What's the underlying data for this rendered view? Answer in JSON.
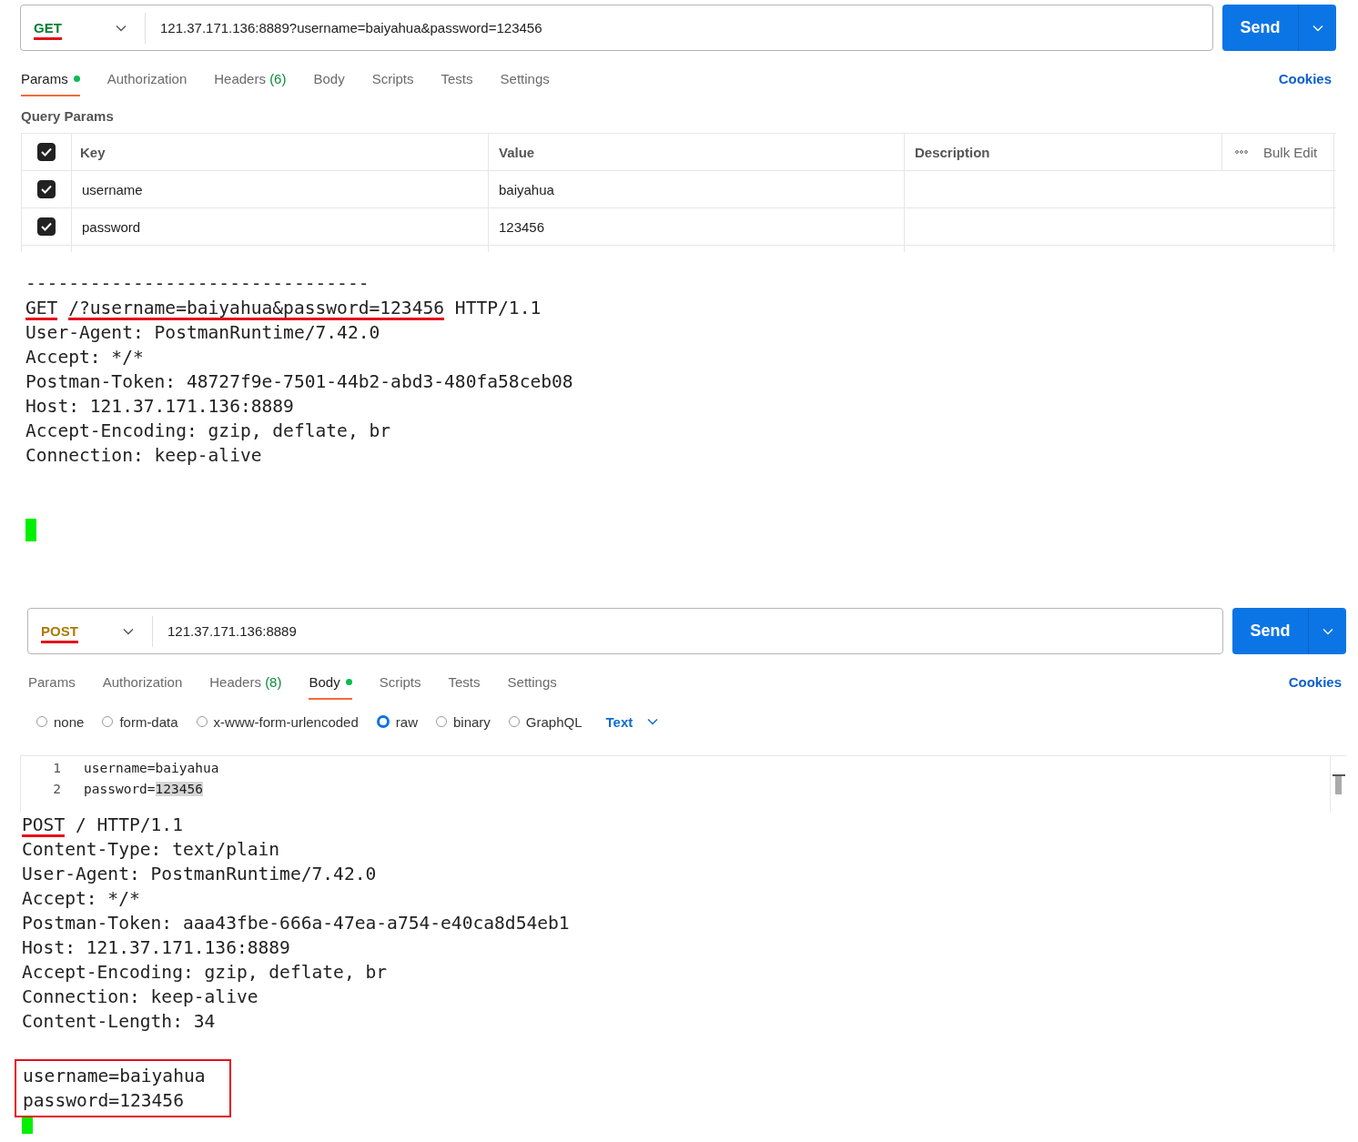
{
  "requests": [
    {
      "method": {
        "text": "GET",
        "kind": "get",
        "underlined": true
      },
      "url": "121.37.171.136:8889?username=baiyahua&password=123456",
      "send": "Send",
      "cookies": "Cookies",
      "tabs": [
        {
          "label": "Params",
          "dot": true,
          "selected": true
        },
        {
          "label": "Authorization",
          "dot": false,
          "selected": false
        },
        {
          "label": "Headers",
          "count": "(6)",
          "dot": false,
          "selected": false
        },
        {
          "label": "Body",
          "dot": false,
          "selected": false
        },
        {
          "label": "Scripts",
          "dot": false,
          "selected": false
        },
        {
          "label": "Tests",
          "dot": false,
          "selected": false
        },
        {
          "label": "Settings",
          "dot": false,
          "selected": false
        }
      ],
      "content": {
        "kind": "params",
        "title": "Query Params",
        "header_checked": true,
        "columns": [
          "Key",
          "Value",
          "Description"
        ],
        "bulk_edit": "Bulk Edit",
        "rows": [
          {
            "checked": true,
            "key": "username",
            "value": "baiyahua"
          },
          {
            "checked": true,
            "key": "password",
            "value": "123456"
          }
        ]
      },
      "terminal": {
        "blocks": [
          {
            "kind": "text",
            "boxed": false,
            "lines": [
              {
                "parts": [
                  {
                    "text": "--------------------------------",
                    "underlined": false
                  }
                ]
              },
              {
                "parts": [
                  {
                    "text": "GET",
                    "underlined": true
                  },
                  {
                    "text": "/?username=baiyahua&password=123456",
                    "underlined": true
                  },
                  {
                    "text": " HTTP/1.1",
                    "underlined": false
                  }
                ]
              },
              {
                "parts": [
                  {
                    "text": "User-Agent: PostmanRuntime/7.42.0",
                    "underlined": false
                  }
                ]
              },
              {
                "parts": [
                  {
                    "text": "Accept: */*",
                    "underlined": false
                  }
                ]
              },
              {
                "parts": [
                  {
                    "text": "Postman-Token: 48727f9e-7501-44b2-abd3-480fa58ceb08",
                    "underlined": false
                  }
                ]
              },
              {
                "parts": [
                  {
                    "text": "Host: 121.37.171.136:8889",
                    "underlined": false
                  }
                ]
              },
              {
                "parts": [
                  {
                    "text": "Accept-Encoding: gzip, deflate, br",
                    "underlined": false
                  }
                ]
              },
              {
                "parts": [
                  {
                    "text": "Connection: keep-alive",
                    "underlined": false
                  }
                ]
              }
            ]
          },
          {
            "kind": "cursor"
          }
        ]
      }
    },
    {
      "method": {
        "text": "POST",
        "kind": "post",
        "underlined": true
      },
      "url": "121.37.171.136:8889",
      "send": "Send",
      "cookies": "Cookies",
      "tabs": [
        {
          "label": "Params",
          "dot": false,
          "selected": false
        },
        {
          "label": "Authorization",
          "dot": false,
          "selected": false
        },
        {
          "label": "Headers",
          "count": "(8)",
          "dot": false,
          "selected": false
        },
        {
          "label": "Body",
          "dot": true,
          "selected": true
        },
        {
          "label": "Scripts",
          "dot": false,
          "selected": false
        },
        {
          "label": "Tests",
          "dot": false,
          "selected": false
        },
        {
          "label": "Settings",
          "dot": false,
          "selected": false
        }
      ],
      "content": {
        "kind": "body",
        "format": "Text",
        "options": [
          {
            "label": "none",
            "selected": false
          },
          {
            "label": "form-data",
            "selected": false
          },
          {
            "label": "x-www-form-urlencoded",
            "selected": false
          },
          {
            "label": "raw",
            "selected": true
          },
          {
            "label": "binary",
            "selected": false
          },
          {
            "label": "GraphQL",
            "selected": false
          }
        ],
        "lines": [
          {
            "number": "1",
            "parts": [
              {
                "text": "username=baiyahua",
                "highlighted": false
              }
            ]
          },
          {
            "number": "2",
            "parts": [
              {
                "text": "password=",
                "highlighted": false
              },
              {
                "text": "123456",
                "highlighted": true
              }
            ]
          }
        ]
      },
      "terminal": {
        "blocks": [
          {
            "kind": "text",
            "boxed": false,
            "lines": [
              {
                "parts": [
                  {
                    "text": "POST",
                    "underlined": true
                  },
                  {
                    "text": " / HTTP/1.1",
                    "underlined": false
                  }
                ]
              },
              {
                "parts": [
                  {
                    "text": "Content-Type: text/plain",
                    "underlined": false
                  }
                ]
              },
              {
                "parts": [
                  {
                    "text": "User-Agent: PostmanRuntime/7.42.0",
                    "underlined": false
                  }
                ]
              },
              {
                "parts": [
                  {
                    "text": "Accept: */*",
                    "underlined": false
                  }
                ]
              },
              {
                "parts": [
                  {
                    "text": "Postman-Token: aaa43fbe-666a-47ea-a754-e40ca8d54eb1",
                    "underlined": false
                  }
                ]
              },
              {
                "parts": [
                  {
                    "text": "Host: 121.37.171.136:8889",
                    "underlined": false
                  }
                ]
              },
              {
                "parts": [
                  {
                    "text": "Accept-Encoding: gzip, deflate, br",
                    "underlined": false
                  }
                ]
              },
              {
                "parts": [
                  {
                    "text": "Connection: keep-alive",
                    "underlined": false
                  }
                ]
              },
              {
                "parts": [
                  {
                    "text": "Content-Length: 34",
                    "underlined": false
                  }
                ]
              }
            ]
          },
          {
            "kind": "text",
            "boxed": true,
            "lines": [
              {
                "parts": [
                  {
                    "text": "username=baiyahua",
                    "underlined": false
                  }
                ]
              },
              {
                "parts": [
                  {
                    "text": "password=123456",
                    "underlined": false
                  }
                ]
              }
            ]
          },
          {
            "kind": "cursor"
          }
        ]
      }
    }
  ]
}
